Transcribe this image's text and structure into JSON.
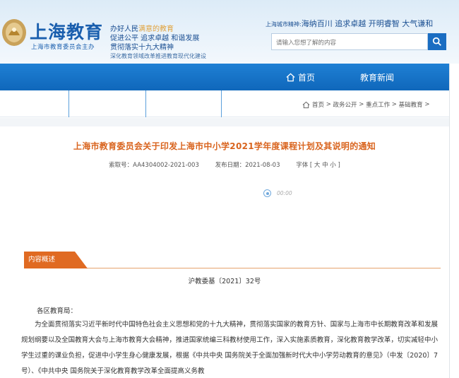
{
  "header": {
    "logo_title": "上海教育",
    "logo_sub": "上海市教育委员会主办",
    "slogans": [
      {
        "main": "办好人民",
        "highlight": "满意的教育"
      },
      {
        "main": "促进公平 追求卓越 和谐发展",
        "highlight": ""
      },
      {
        "main": "贯彻落实十九大精神",
        "highlight": ""
      }
    ],
    "slogan_small": "深化教育领域改革推进教育现代化建设",
    "spirit_label": "上海城市精神:",
    "spirit_text": "海纳百川 追求卓越 开明睿智 大气谦和",
    "search_placeholder": "请输入您想了解的内容"
  },
  "nav": {
    "home": "首页",
    "news": "教育新闻"
  },
  "breadcrumb": [
    "首页",
    "政务公开",
    "重点工作",
    "基础教育"
  ],
  "article": {
    "title": "上海市教育委员会关于印发上海市中小学2021学年度课程计划及其说明的通知",
    "index_no": "索取号：AA4304002-2021-003",
    "date": "发布日期：2021-08-03",
    "font_size": "字体 [ 大 中 小 ]",
    "audio_time": "00:00",
    "section_tag": "内容概述",
    "doc_no": "沪教委基〔2021〕32号",
    "greeting": "各区教育局：",
    "body": "为全面贯彻落实习近平新时代中国特色社会主义思想和党的十九大精神，贯彻落实国家的教育方针、国家与上海市中长期教育改革和发展规划纲要以及全国教育大会与上海市教育大会精神，推进国家统编三科教材使用工作，深入实施素质教育，深化教育教学改革，切实减轻中小学生过重的课业负担，促进中小学生身心健康发展，根据《中共中央 国务院关于全面加强新时代大中小学劳动教育的意见》（中发〔2020〕7号）、《中共中央 国务院关于深化教育教学改革全面提高义务教"
  },
  "colors": {
    "brand_blue": "#1a6dc2",
    "title_orange": "#d9641e",
    "tag_orange": "#e06a22"
  }
}
